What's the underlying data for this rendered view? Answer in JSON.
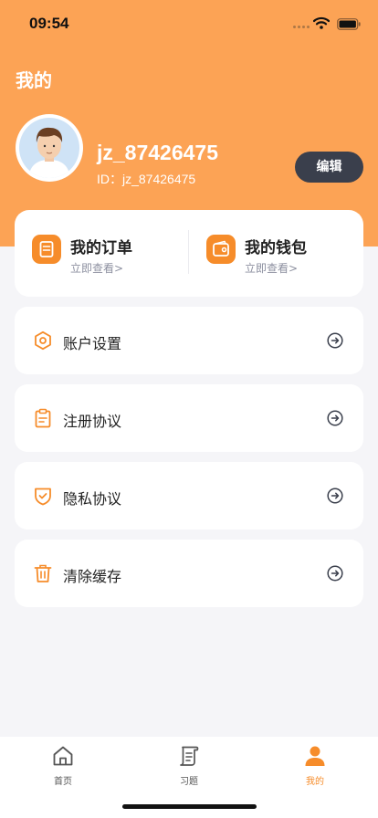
{
  "status_bar": {
    "time": "09:54"
  },
  "header": {
    "title": "我的",
    "username": "jz_87426475",
    "user_id": "ID：jz_87426475",
    "edit_label": "编辑"
  },
  "quick_links": [
    {
      "title": "我的订单",
      "subtitle": "立即查看>",
      "icon": "order-icon"
    },
    {
      "title": "我的钱包",
      "subtitle": "立即查看>",
      "icon": "wallet-icon"
    }
  ],
  "menu": [
    {
      "label": "账户设置",
      "icon": "settings-icon"
    },
    {
      "label": "注册协议",
      "icon": "clipboard-icon"
    },
    {
      "label": "隐私协议",
      "icon": "shield-icon"
    },
    {
      "label": "清除缓存",
      "icon": "trash-icon"
    }
  ],
  "tabs": [
    {
      "label": "首页",
      "icon": "home-icon",
      "active": false
    },
    {
      "label": "习题",
      "icon": "scroll-icon",
      "active": false
    },
    {
      "label": "我的",
      "icon": "user-icon",
      "active": true
    }
  ],
  "colors": {
    "accent": "#f68c2a",
    "header": "#fca355",
    "edit_button": "#3a3f4c"
  }
}
